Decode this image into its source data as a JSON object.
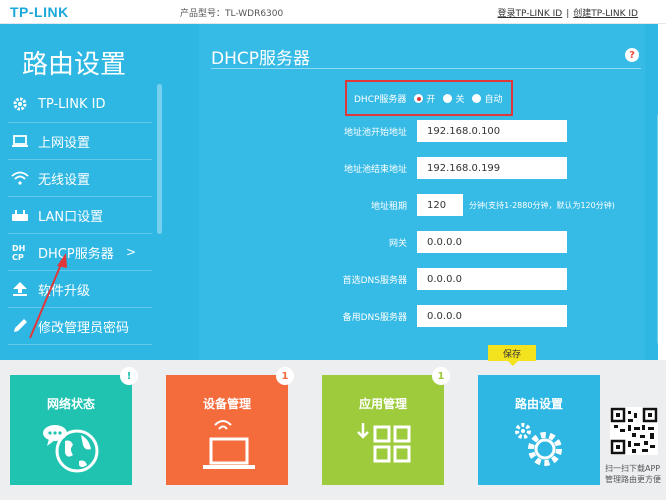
{
  "header": {
    "logo": "TP-LINK",
    "model": "产品型号：TL-WDR6300",
    "link_login": "登录TP-LINK ID",
    "link_create": "创建TP-LINK ID",
    "separator": "|"
  },
  "sidebar": {
    "title": "路由设置",
    "items": [
      {
        "label": "TP-LINK ID",
        "icon": "gear-icon"
      },
      {
        "label": "上网设置",
        "icon": "laptop-icon"
      },
      {
        "label": "无线设置",
        "icon": "wifi-icon"
      },
      {
        "label": "LAN口设置",
        "icon": "router-icon"
      },
      {
        "label": "DHCP服务器",
        "icon": "dhcp-icon",
        "arrow": ">"
      },
      {
        "label": "软件升级",
        "icon": "upgrade-icon"
      },
      {
        "label": "修改管理员密码",
        "icon": "pencil-icon"
      }
    ]
  },
  "main": {
    "section_title": "DHCP服务器",
    "help": "?",
    "dhcp": {
      "label": "DHCP服务器",
      "options": [
        {
          "label": "开",
          "selected": true
        },
        {
          "label": "关",
          "selected": false
        },
        {
          "label": "自动",
          "selected": false
        }
      ]
    },
    "fields": {
      "start_label": "地址池开始地址",
      "start_value": "192.168.0.100",
      "end_label": "地址池结束地址",
      "end_value": "192.168.0.199",
      "lease_label": "地址租期",
      "lease_value": "120",
      "lease_hint": "分钟(支持1-2880分钟，默认为120分钟)",
      "gateway_label": "网关",
      "gateway_value": "0.0.0.0",
      "dns1_label": "首选DNS服务器",
      "dns1_value": "0.0.0.0",
      "dns2_label": "备用DNS服务器",
      "dns2_value": "0.0.0.0"
    },
    "save_label": "保存"
  },
  "tiles": [
    {
      "label": "网络状态",
      "badge": "!",
      "color": "#1fc3b0",
      "badge_color": "#1fc3b0"
    },
    {
      "label": "设备管理",
      "badge": "1",
      "color": "#f46b3c",
      "badge_color": "#f46b3c"
    },
    {
      "label": "应用管理",
      "badge": "1",
      "color": "#9dcb3b",
      "badge_color": "#9dcb3b"
    },
    {
      "label": "路由设置",
      "color": "#2fb7e3"
    }
  ],
  "app_promo": {
    "line1": "扫一扫下载APP",
    "line2": "管理路由更方便"
  },
  "colors": {
    "accent": "#2fb7e3",
    "highlight": "#e0373a",
    "save": "#f3e21e"
  }
}
